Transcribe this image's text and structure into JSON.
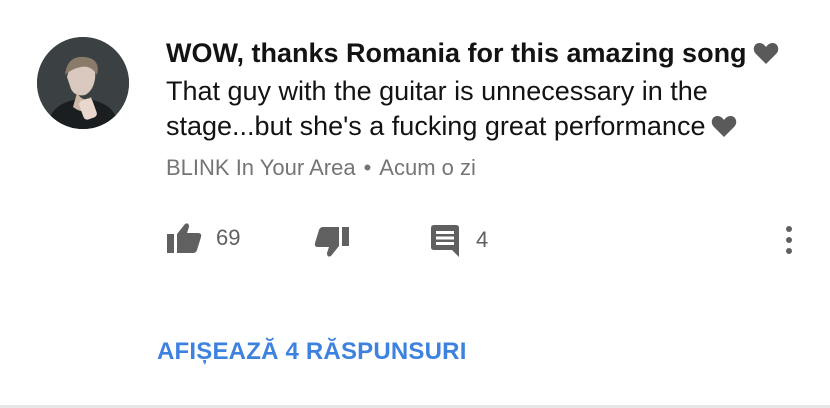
{
  "comment": {
    "lines": [
      "WOW, thanks Romania for this amazing song",
      "That guy with the guitar is unnecessary in the",
      "stage...but she's a fucking great performance"
    ],
    "author": "BLINK In Your Area",
    "separator": "•",
    "time": "Acum o zi"
  },
  "actions": {
    "like_count": "69",
    "reply_count": "4"
  },
  "replies": {
    "show_label": "AFIȘEAZĂ 4 RĂSPUNSURI"
  },
  "icons": {
    "heart": "black-heart-icon",
    "like": "thumbs-up-icon",
    "dislike": "thumbs-down-icon",
    "reply": "comment-icon",
    "more": "more-vertical-icon"
  },
  "colors": {
    "text": "#131313",
    "meta": "#757575",
    "icon": "#606060",
    "link": "#3e82e0"
  }
}
